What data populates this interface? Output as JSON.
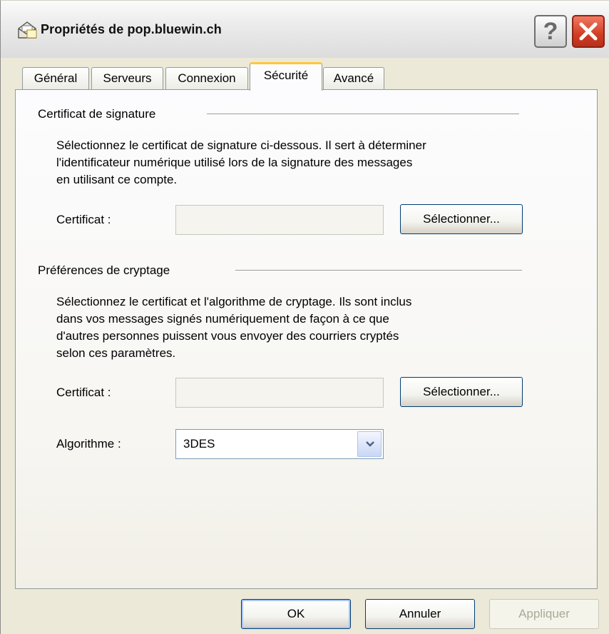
{
  "window": {
    "title": "Propriétés de pop.bluewin.ch",
    "help_label": "?"
  },
  "tabs": [
    {
      "label": "Général"
    },
    {
      "label": "Serveurs"
    },
    {
      "label": "Connexion"
    },
    {
      "label": "Sécurité"
    },
    {
      "label": "Avancé"
    }
  ],
  "active_tab": "Sécurité",
  "signing": {
    "group_label": "Certificat de signature",
    "description_lines": [
      "Sélectionnez le certificat de signature ci-dessous. Il sert à déterminer",
      "l'identificateur numérique utilisé lors de la signature des messages",
      "en utilisant ce compte."
    ],
    "cert_label": "Certificat :",
    "cert_value": "",
    "select_button": "Sélectionner..."
  },
  "encryption": {
    "group_label": "Préférences de cryptage",
    "description_lines": [
      "Sélectionnez le certificat et l'algorithme de cryptage. Ils sont inclus",
      "dans vos messages signés numériquement de façon à ce que",
      "d'autres personnes puissent vous envoyer des courriers cryptés",
      "selon ces paramètres."
    ],
    "cert_label": "Certificat :",
    "cert_value": "",
    "select_button": "Sélectionner...",
    "algo_label": "Algorithme :",
    "algo_value": "3DES"
  },
  "footer": {
    "ok": "OK",
    "cancel": "Annuler",
    "apply": "Appliquer"
  },
  "colors": {
    "window_bg": "#ece9d8",
    "active_tab_accent": "#ffc83c",
    "close_button": "#d13d24",
    "disabled_text": "#aca899"
  }
}
